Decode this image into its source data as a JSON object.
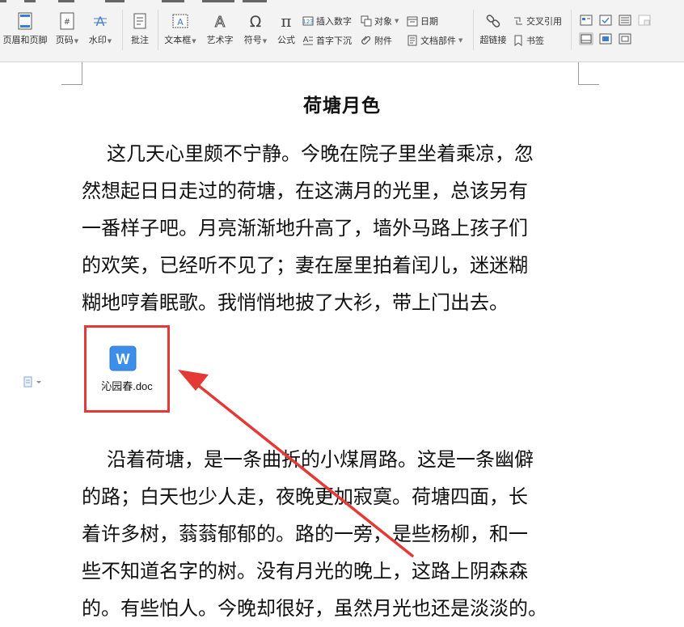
{
  "toolbar": {
    "header_footer": "页眉和页脚",
    "page_number": "页码",
    "watermark": "水印",
    "comment": "批注",
    "text_box": "文本框",
    "word_art": "艺术字",
    "symbol": "符号",
    "formula": "公式",
    "insert_number": "插入数字",
    "object": "对象",
    "date": "日期",
    "drop_cap": "首字下沉",
    "attachment": "附件",
    "doc_parts": "文档部件",
    "hyperlink": "超链接",
    "cross_reference": "交叉引用",
    "bookmark": "书签"
  },
  "document": {
    "title": "荷塘月色",
    "paragraph1": [
      "这几天心里颇不宁静。今晚在院子里坐着乘凉，忽",
      "然想起日日走过的荷塘，在这满月的光里，总该另有",
      "一番样子吧。月亮渐渐地升高了，墙外马路上孩子们",
      "的欢笑，已经听不见了；妻在屋里拍着闰儿，迷迷糊",
      "糊地哼着眠歌。我悄悄地披了大衫，带上门出去。"
    ],
    "attachment_name": "沁园春.doc",
    "paragraph2": [
      "沿着荷塘，是一条曲折的小煤屑路。这是一条幽僻",
      "的路；白天也少人走，夜晚更加寂寞。荷塘四面，长",
      "着许多树，蓊蓊郁郁的。路的一旁，是些杨柳，和一",
      "些不知道名字的树。没有月光的晚上，这路上阴森森",
      "的。有些怕人。今晚却很好，虽然月光也还是淡淡的。"
    ]
  },
  "colors": {
    "highlight_box": "#e53935",
    "wps_icon": "#3d8ee8"
  }
}
